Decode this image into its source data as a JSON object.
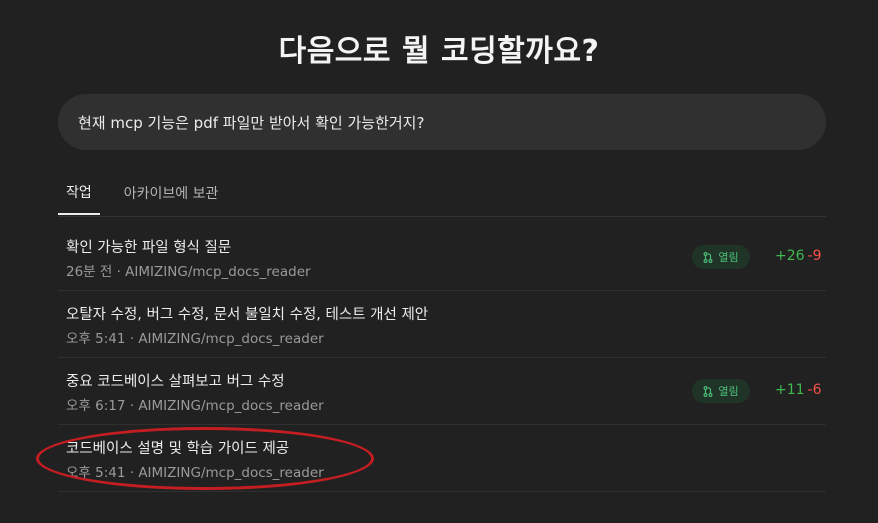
{
  "heading": "다음으로 뭘 코딩할까요?",
  "prompt": {
    "text": "현재 mcp 기능은 pdf 파일만 받아서 확인 가능한거지?"
  },
  "tabs": [
    {
      "label": "작업",
      "active": true
    },
    {
      "label": "아카이브에 보관",
      "active": false
    }
  ],
  "tasks": [
    {
      "title": "확인 가능한 파일 형식 질문",
      "meta": "26분 전 · AIMIZING/mcp_docs_reader",
      "badge": "열림",
      "additions": "+26",
      "deletions": "-9"
    },
    {
      "title": "오탈자 수정, 버그 수정, 문서 불일치 수정, 테스트 개선 제안",
      "meta": "오후 5:41 · AIMIZING/mcp_docs_reader"
    },
    {
      "title": "중요 코드베이스 살펴보고 버그 수정",
      "meta": "오후 6:17 · AIMIZING/mcp_docs_reader",
      "badge": "열림",
      "additions": "+11",
      "deletions": "-6"
    },
    {
      "title": "코드베이스 설명 및 학습 가이드 제공",
      "meta": "오후 5:41 · AIMIZING/mcp_docs_reader"
    }
  ],
  "colors": {
    "background": "#212121",
    "additions": "#3fb950",
    "deletions": "#f85149",
    "badge_text": "#4cc07a",
    "annotation": "#c41e23"
  },
  "icons": {
    "badge": "pull-request-icon"
  }
}
